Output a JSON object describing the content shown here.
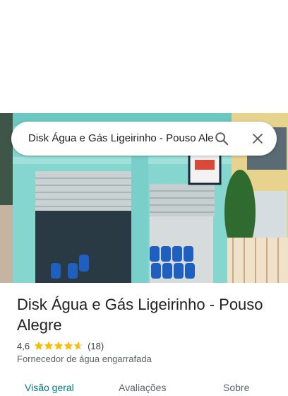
{
  "search": {
    "query": "Disk Água e Gás Ligeirinho - Pouso Alegre"
  },
  "place": {
    "name": "Disk Água e Gás Ligeirinho - Pouso Alegre",
    "rating": "4,6",
    "rating_stars": 4.6,
    "reviews_count": "(18)",
    "category": "Fornecedor de água engarrafada"
  },
  "tabs": [
    {
      "label": "Visão geral",
      "active": true
    },
    {
      "label": "Avaliações",
      "active": false
    },
    {
      "label": "Sobre",
      "active": false
    }
  ],
  "colors": {
    "star": "#fbbc04",
    "active_tab": "#007b83"
  },
  "icons": {
    "search": "search-icon",
    "close": "close-icon"
  }
}
